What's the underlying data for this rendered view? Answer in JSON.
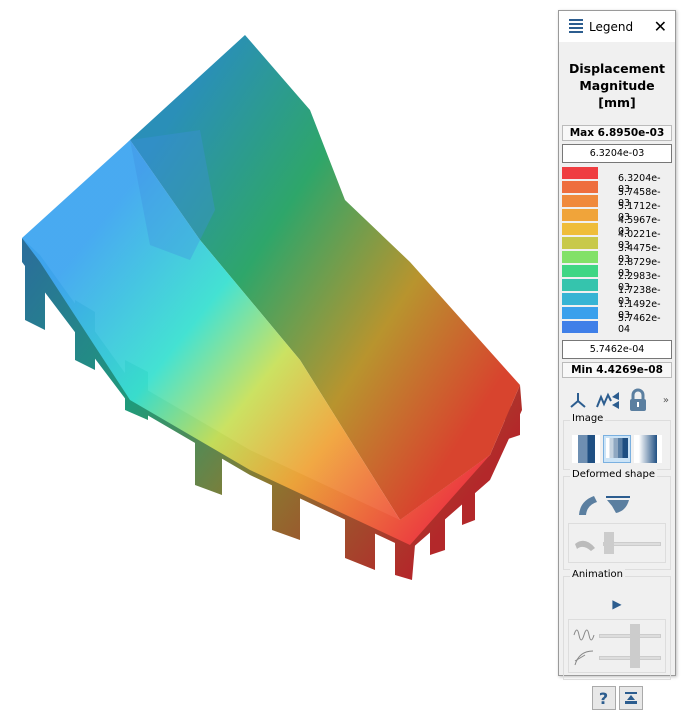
{
  "legend": {
    "header": "Legend",
    "title_line1": "Displacement",
    "title_line2": "Magnitude [mm]",
    "max_label": "Max  6.8950e-03",
    "upper_bound": "6.3204e-03",
    "lower_bound": "5.7462e-04",
    "min_label": "Min  4.4269e-08",
    "levels": [
      "6.3204e-03",
      "5.7458e-03",
      "5.1712e-03",
      "4.5967e-03",
      "4.0221e-03",
      "3.4475e-03",
      "2.8729e-03",
      "2.2983e-03",
      "1.7238e-03",
      "1.1492e-03",
      "5.7462e-04"
    ],
    "colors": [
      "#ef3d41",
      "#ee6e3e",
      "#f08a3c",
      "#f0a43a",
      "#efbd3a",
      "#c8c94a",
      "#82e168",
      "#3fd684",
      "#35c4ad",
      "#36b4d4",
      "#3aa0ec",
      "#3f7fe8"
    ]
  },
  "sections": {
    "image": "Image",
    "deformed": "Deformed shape",
    "animation": "Animation"
  },
  "more": "»",
  "sliders": {
    "deform_scale": 0.1,
    "frequency": 0.58,
    "damping": 0.58
  },
  "help": "?"
}
